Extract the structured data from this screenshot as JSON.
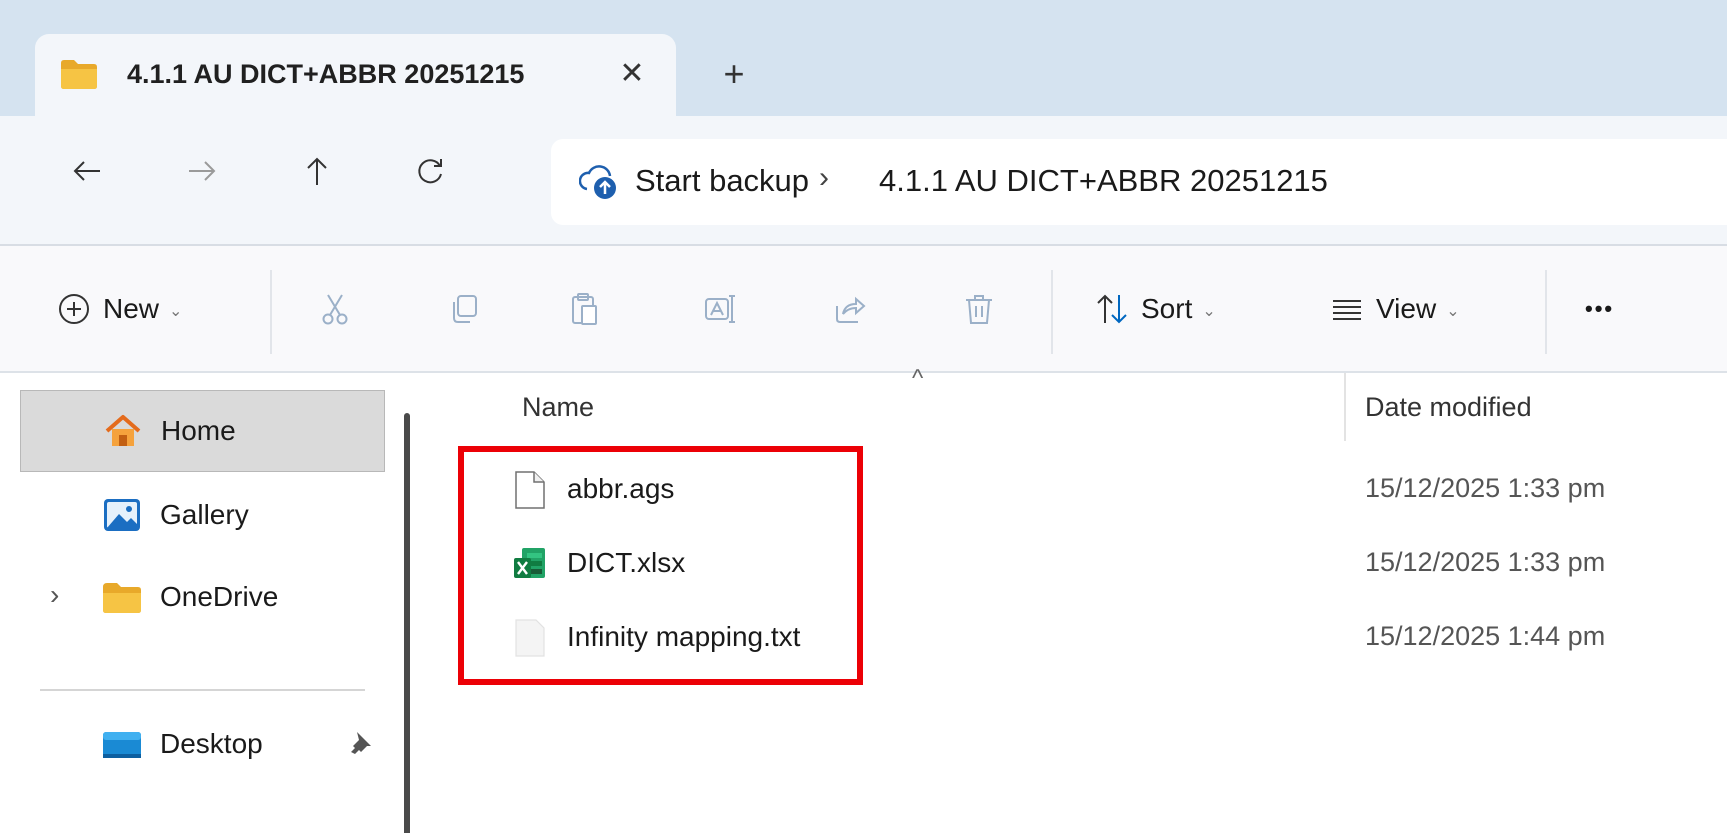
{
  "tab": {
    "title": "4.1.1 AU DICT+ABBR 20251215",
    "close": "✕",
    "new_tab": "+"
  },
  "address": {
    "crumbs": [
      "Start backup",
      "4.1.1 AU DICT+ABBR 20251215"
    ],
    "separator": "›"
  },
  "toolbar": {
    "new": "New",
    "sort": "Sort",
    "view": "View",
    "more": "•••"
  },
  "sidebar": {
    "items": [
      {
        "label": "Home",
        "icon": "home-icon",
        "selected": true
      },
      {
        "label": "Gallery",
        "icon": "gallery-icon"
      },
      {
        "label": "OneDrive",
        "icon": "folder-icon",
        "expander": "›"
      },
      {
        "label": "Desktop",
        "icon": "desktop-icon",
        "pinned": true
      }
    ]
  },
  "columns": {
    "name": "Name",
    "date": "Date modified"
  },
  "files": [
    {
      "name": "abbr.ags",
      "date": "15/12/2025 1:33 pm",
      "icon": "generic-file-icon"
    },
    {
      "name": "DICT.xlsx",
      "date": "15/12/2025 1:33 pm",
      "icon": "excel-file-icon"
    },
    {
      "name": "Infinity mapping.txt",
      "date": "15/12/2025 1:44 pm",
      "icon": "text-file-icon"
    }
  ],
  "colors": {
    "titlebar": "#d5e3f0",
    "accent": "#0067c0",
    "highlight": "#ec0006"
  }
}
